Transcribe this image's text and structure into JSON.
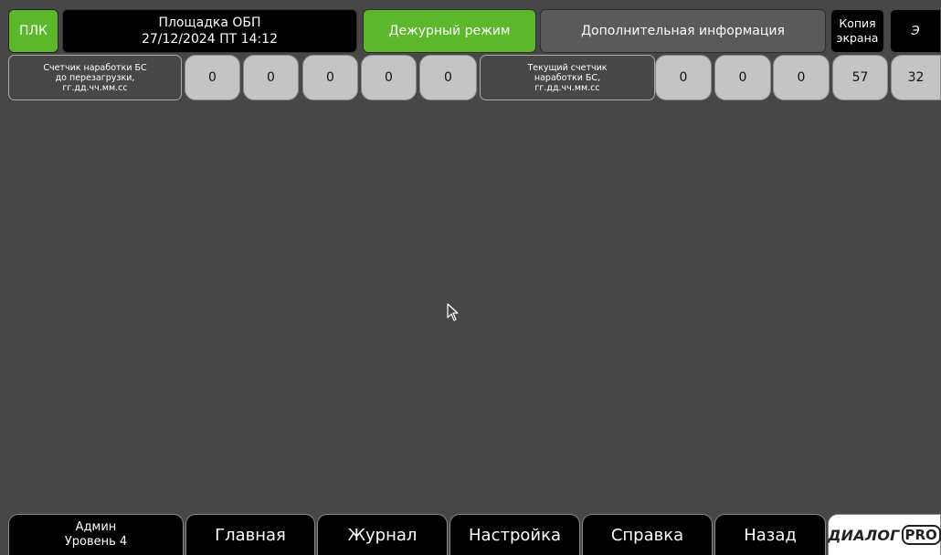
{
  "header": {
    "plc_label": "ПЛК",
    "site_name": "Площадка ОБП",
    "datetime": "27/12/2024 ПТ 14:12",
    "mode_label": "Дежурный режим",
    "additional_info_label": "Дополнительная информация",
    "screenshot_line1": "Копия",
    "screenshot_line2": "экрана",
    "e_label": "Э"
  },
  "counters": {
    "uptime_label_line1": "Счетчик наработки БС",
    "uptime_label_line2": "до перезагрузки,",
    "uptime_label_line3": "гг.дд.чч.мм.сс",
    "uptime_values": [
      "0",
      "0",
      "0",
      "0",
      "0"
    ],
    "current_label_line1": "Текущий счетчик",
    "current_label_line2": "наработки БС,",
    "current_label_line3": "гг.дд.чч.мм.сс",
    "current_values": [
      "0",
      "0",
      "0",
      "57",
      "32"
    ]
  },
  "footer": {
    "user_line1": "Админ",
    "user_line2": "Уровень 4",
    "nav": {
      "main": "Главная",
      "journal": "Журнал",
      "settings": "Настройка",
      "help": "Справка",
      "back": "Назад"
    },
    "logo_text": "ДИАЛОГ",
    "logo_pro": "PRO"
  },
  "colors": {
    "accent_green": "#5cb82a",
    "background": "#474747",
    "value_cell": "#c4c4c4"
  }
}
